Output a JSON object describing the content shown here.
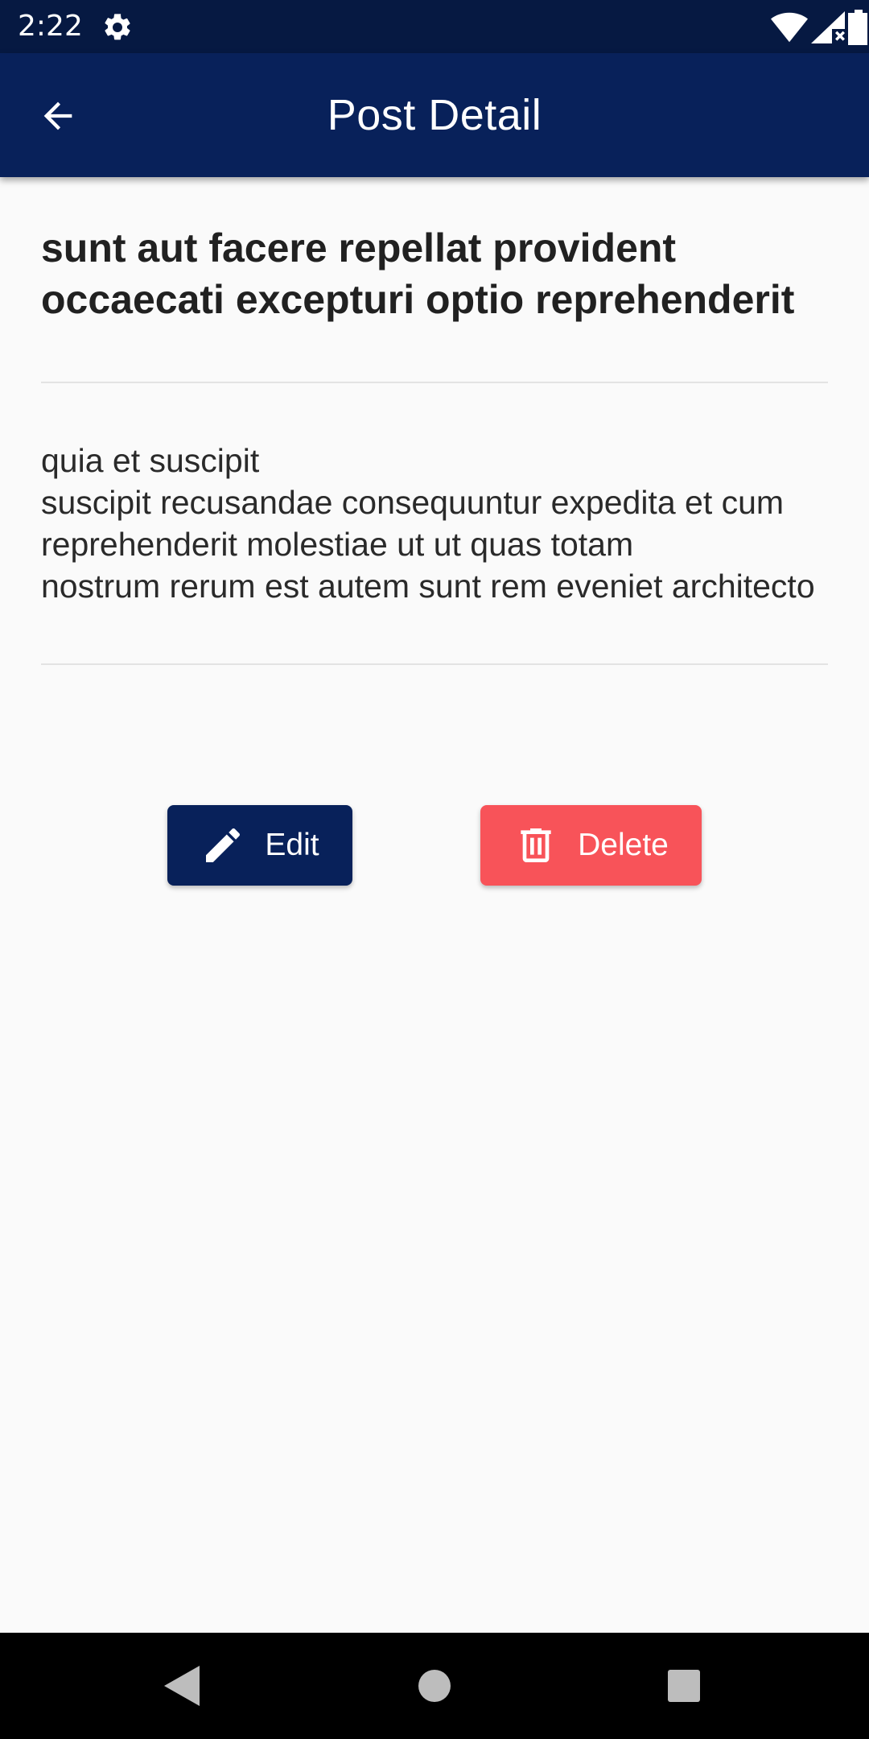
{
  "status_bar": {
    "time": "2:22",
    "icons": [
      "settings-gear-icon",
      "wifi-icon",
      "signal-icon",
      "battery-icon"
    ]
  },
  "app_bar": {
    "title": "Post Detail",
    "back_icon": "arrow-back-icon"
  },
  "post": {
    "title": "sunt aut facere repellat provident occaecati excepturi optio reprehenderit",
    "body": "quia et suscipit\nsuscipit recusandae consequuntur expedita et cum\nreprehenderit molestiae ut ut quas totam\nnostrum rerum est autem sunt rem eveniet architecto"
  },
  "actions": {
    "edit_label": "Edit",
    "edit_icon": "pencil-icon",
    "delete_label": "Delete",
    "delete_icon": "trash-icon"
  },
  "nav_bar": {
    "icons": [
      "nav-back-icon",
      "nav-home-icon",
      "nav-recents-icon"
    ]
  },
  "colors": {
    "status_bar": "#061942",
    "app_bar": "#08215a",
    "edit_button": "#08215a",
    "delete_button": "#f85359",
    "background": "#fafafa"
  }
}
